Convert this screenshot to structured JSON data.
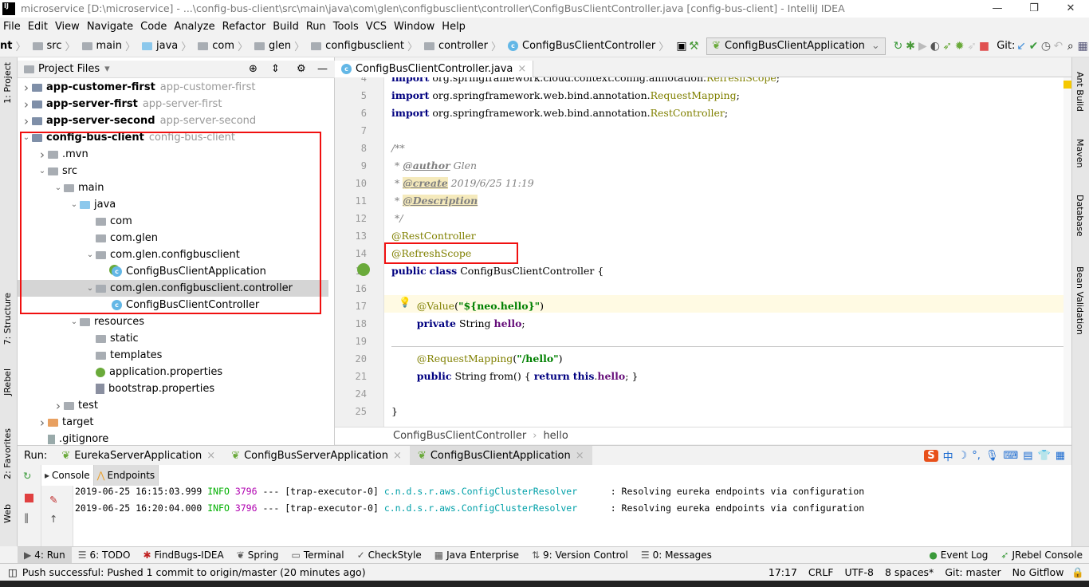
{
  "title": "microservice [D:\\microservice] - ...\\config-bus-client\\src\\main\\java\\com\\glen\\configbusclient\\controller\\ConfigBusClientController.java [config-bus-client] - IntelliJ IDEA",
  "logo": "IJ",
  "menu": [
    "File",
    "Edit",
    "View",
    "Navigate",
    "Code",
    "Analyze",
    "Refactor",
    "Build",
    "Run",
    "Tools",
    "VCS",
    "Window",
    "Help"
  ],
  "nav_crumbs": [
    {
      "label": "nt",
      "icon": "none"
    },
    {
      "label": "src",
      "icon": "folder"
    },
    {
      "label": "main",
      "icon": "folder"
    },
    {
      "label": "java",
      "icon": "source-folder"
    },
    {
      "label": "com",
      "icon": "package"
    },
    {
      "label": "glen",
      "icon": "package"
    },
    {
      "label": "configbusclient",
      "icon": "package"
    },
    {
      "label": "controller",
      "icon": "package"
    },
    {
      "label": "ConfigBusClientController",
      "icon": "class"
    }
  ],
  "run_config": "ConfigBusClientApplication",
  "git_label": "Git:",
  "left_tabs": [
    "1: Project",
    "7: Structure",
    "JRebel",
    "2: Favorites",
    "Web"
  ],
  "right_tabs": [
    "Ant Build",
    "Maven",
    "Database",
    "Bean Validation"
  ],
  "project": {
    "header": "Project Files",
    "tree": [
      {
        "name": "app-customer-first",
        "sec": "app-customer-first",
        "level": 0,
        "arrow": "right",
        "bold": true,
        "icon": "module"
      },
      {
        "name": "app-server-first",
        "sec": "app-server-first",
        "level": 0,
        "arrow": "right",
        "bold": true,
        "icon": "module"
      },
      {
        "name": "app-server-second",
        "sec": "app-server-second",
        "level": 0,
        "arrow": "right",
        "bold": true,
        "icon": "module"
      },
      {
        "name": "config-bus-client",
        "sec": "config-bus-client",
        "level": 0,
        "arrow": "down",
        "bold": true,
        "icon": "module"
      },
      {
        "name": ".mvn",
        "level": 1,
        "arrow": "right",
        "icon": "folder"
      },
      {
        "name": "src",
        "level": 1,
        "arrow": "down",
        "icon": "folder"
      },
      {
        "name": "main",
        "level": 2,
        "arrow": "down",
        "icon": "folder"
      },
      {
        "name": "java",
        "level": 3,
        "arrow": "down",
        "icon": "source-folder"
      },
      {
        "name": "com",
        "level": 4,
        "arrow": "",
        "icon": "package"
      },
      {
        "name": "com.glen",
        "level": 4,
        "arrow": "",
        "icon": "package"
      },
      {
        "name": "com.glen.configbusclient",
        "level": 4,
        "arrow": "down",
        "icon": "package"
      },
      {
        "name": "ConfigBusClientApplication",
        "level": 5,
        "arrow": "",
        "icon": "spring-class"
      },
      {
        "name": "com.glen.configbusclient.controller",
        "level": 4,
        "arrow": "down",
        "icon": "package",
        "selected": true
      },
      {
        "name": "ConfigBusClientController",
        "level": 5,
        "arrow": "",
        "icon": "class"
      },
      {
        "name": "resources",
        "level": 3,
        "arrow": "down",
        "icon": "folder"
      },
      {
        "name": "static",
        "level": 4,
        "arrow": "",
        "icon": "folder"
      },
      {
        "name": "templates",
        "level": 4,
        "arrow": "",
        "icon": "folder"
      },
      {
        "name": "application.properties",
        "level": 4,
        "arrow": "",
        "icon": "spring-properties"
      },
      {
        "name": "bootstrap.properties",
        "level": 4,
        "arrow": "",
        "icon": "properties"
      },
      {
        "name": "test",
        "level": 2,
        "arrow": "right",
        "icon": "folder"
      },
      {
        "name": "target",
        "level": 1,
        "arrow": "right",
        "icon": "folder-orange"
      },
      {
        "name": ".gitignore",
        "level": 1,
        "arrow": "",
        "icon": "file"
      }
    ]
  },
  "editor": {
    "tab": "ConfigBusClientController.java",
    "lines": [
      {
        "n": "4",
        "segs": [
          [
            "import",
            "kw"
          ],
          [
            " org.springframework.cloud.context.config.annotation.",
            ""
          ],
          [
            "RefreshScope",
            "an"
          ],
          [
            ";",
            ""
          ]
        ]
      },
      {
        "n": "5",
        "segs": [
          [
            "import",
            "kw"
          ],
          [
            " org.springframework.web.bind.annotation.",
            ""
          ],
          [
            "RequestMapping",
            "an"
          ],
          [
            ";",
            ""
          ]
        ]
      },
      {
        "n": "6",
        "segs": [
          [
            "import",
            "kw"
          ],
          [
            " org.springframework.web.bind.annotation.",
            ""
          ],
          [
            "RestController",
            "an"
          ],
          [
            ";",
            ""
          ]
        ]
      },
      {
        "n": "7",
        "segs": []
      },
      {
        "n": "8",
        "segs": [
          [
            "/**",
            "cm"
          ]
        ]
      },
      {
        "n": "9",
        "segs": [
          [
            " * ",
            "cm"
          ],
          [
            "@author",
            "tag"
          ],
          [
            " Glen",
            "cm"
          ]
        ]
      },
      {
        "n": "10",
        "segs": [
          [
            " * ",
            "cm"
          ],
          [
            "@create",
            "tag hl"
          ],
          [
            " 2019/6/25 11:19",
            "cm"
          ]
        ]
      },
      {
        "n": "11",
        "segs": [
          [
            " * ",
            "cm"
          ],
          [
            "@Description",
            "tag hl"
          ]
        ]
      },
      {
        "n": "12",
        "segs": [
          [
            " */",
            "cm"
          ]
        ]
      },
      {
        "n": "13",
        "segs": [
          [
            "@RestController",
            "an"
          ]
        ]
      },
      {
        "n": "14",
        "segs": [
          [
            "@RefreshScope",
            "an"
          ]
        ]
      },
      {
        "n": "15",
        "segs": [
          [
            "public",
            "kw"
          ],
          [
            " ",
            ""
          ],
          [
            "class",
            "kw"
          ],
          [
            " ConfigBusClientController {",
            ""
          ]
        ]
      },
      {
        "n": "16",
        "segs": []
      },
      {
        "n": "17",
        "segs": [
          [
            "    ",
            ""
          ],
          [
            "    @Value",
            "an"
          ],
          [
            "(",
            ""
          ],
          [
            "\"${neo.hello}\"",
            "st"
          ],
          [
            ")",
            ""
          ]
        ]
      },
      {
        "n": "18",
        "segs": [
          [
            "        ",
            ""
          ],
          [
            "private",
            "kw"
          ],
          [
            " String ",
            ""
          ],
          [
            "hello",
            "fd"
          ],
          [
            ";",
            ""
          ]
        ]
      },
      {
        "n": "19",
        "segs": []
      },
      {
        "n": "20",
        "segs": [
          [
            "        ",
            ""
          ],
          [
            "@RequestMapping",
            "an"
          ],
          [
            "(",
            ""
          ],
          [
            "\"/hello\"",
            "st"
          ],
          [
            ")",
            ""
          ]
        ]
      },
      {
        "n": "21",
        "segs": [
          [
            "        ",
            ""
          ],
          [
            "public",
            "kw"
          ],
          [
            " String from() { ",
            ""
          ],
          [
            "return",
            "kw"
          ],
          [
            " ",
            ""
          ],
          [
            "this",
            "kw"
          ],
          [
            ".",
            ""
          ],
          [
            "hello",
            "fd"
          ],
          [
            "; }",
            ""
          ]
        ]
      },
      {
        "n": "24",
        "segs": []
      },
      {
        "n": "25",
        "segs": [
          [
            "}",
            ""
          ]
        ]
      }
    ],
    "breadcrumb": [
      "ConfigBusClientController",
      "hello"
    ]
  },
  "run": {
    "label": "Run:",
    "tabs": [
      "EurekaServerApplication",
      "ConfigBusServerApplication",
      "ConfigBusClientApplication"
    ],
    "active": 2,
    "console_tabs": [
      "Console",
      "Endpoints"
    ],
    "log": [
      {
        "ts": "2019-06-25 16:15:03.999",
        "level": "INFO",
        "pid": "3796",
        "sep": "---",
        "thread": "[trap-executor-0]",
        "logger": "c.n.d.s.r.aws.ConfigClusterResolver",
        "msg": ": Resolving eureka endpoints via configuration"
      },
      {
        "ts": "2019-06-25 16:20:04.000",
        "level": "INFO",
        "pid": "3796",
        "sep": "---",
        "thread": "[trap-executor-0]",
        "logger": "c.n.d.s.r.aws.ConfigClusterResolver",
        "msg": ": Resolving eureka endpoints via configuration"
      }
    ]
  },
  "toolwindows": [
    "4: Run",
    "6: TODO",
    "FindBugs-IDEA",
    "Spring",
    "Terminal",
    "CheckStyle",
    "Java Enterprise",
    "9: Version Control",
    "0: Messages"
  ],
  "toolwindows_right": [
    "Event Log",
    "JRebel Console"
  ],
  "status": {
    "message": "Push successful: Pushed 1 commit to origin/master (20 minutes ago)",
    "position": "17:17",
    "line_sep": "CRLF",
    "encoding": "UTF-8",
    "indent": "8 spaces*",
    "git": "Git: master",
    "gitflow": "No Gitflow"
  },
  "ime": "中",
  "colors": {
    "accent": "#63b7e6",
    "highlight_box": "#f01010"
  }
}
